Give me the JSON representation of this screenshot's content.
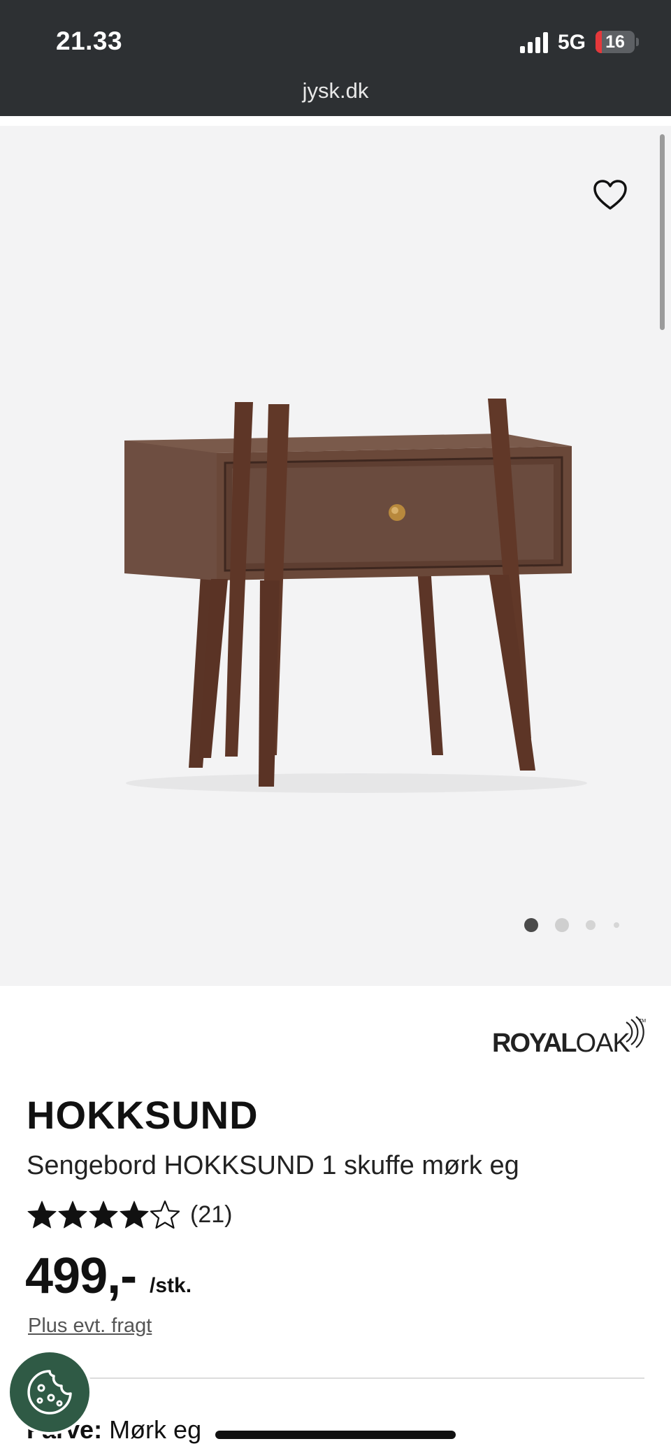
{
  "status_bar": {
    "time": "21.33",
    "network": "5G",
    "battery_level": "16",
    "battery_fraction": 0.16
  },
  "browser": {
    "url": "jysk.dk"
  },
  "gallery": {
    "image_count": 4,
    "active_index": 0,
    "favorite_icon": "heart-outline-icon"
  },
  "product": {
    "brand_logo_text": "ROYAL OAK",
    "name": "HOKKSUND",
    "description": "Sengebord HOKKSUND 1 skuffe mørk eg",
    "rating": 4,
    "rating_max": 5,
    "review_count": "(21)",
    "price": "499,-",
    "price_unit": "/stk.",
    "shipping_note": "Plus evt. fragt",
    "color_label": "Farve:",
    "color_value": "Mørk eg"
  },
  "colors": {
    "topbar_bg": "#2d3033",
    "gallery_bg": "#f3f3f4",
    "cookie_button": "#2f5a45",
    "battery_low": "#e5383b"
  }
}
